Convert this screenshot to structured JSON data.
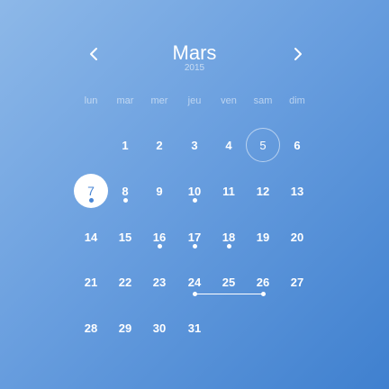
{
  "header": {
    "month": "Mars",
    "year": "2015",
    "prev_icon": "chevron-left-icon",
    "next_icon": "chevron-right-icon"
  },
  "weekdays": [
    "lun",
    "mar",
    "mer",
    "jeu",
    "ven",
    "sam",
    "dim"
  ],
  "weeks": [
    [
      "",
      "1",
      "2",
      "3",
      "4",
      "5",
      "6"
    ],
    [
      "7",
      "8",
      "9",
      "10",
      "11",
      "12",
      "13"
    ],
    [
      "14",
      "15",
      "16",
      "17",
      "18",
      "19",
      "20"
    ],
    [
      "21",
      "22",
      "23",
      "24",
      "25",
      "26",
      "27"
    ],
    [
      "28",
      "29",
      "30",
      "31",
      "",
      "",
      ""
    ]
  ],
  "selected_day": "7",
  "today_day": "5",
  "event_days": [
    "7",
    "8",
    "10",
    "16",
    "17",
    "18"
  ],
  "range": {
    "start": "24",
    "end": "26"
  },
  "colors": {
    "accent": "#4a86d4",
    "background_start": "#8db8e8",
    "background_end": "#3f80cf",
    "text": "#ffffff"
  }
}
